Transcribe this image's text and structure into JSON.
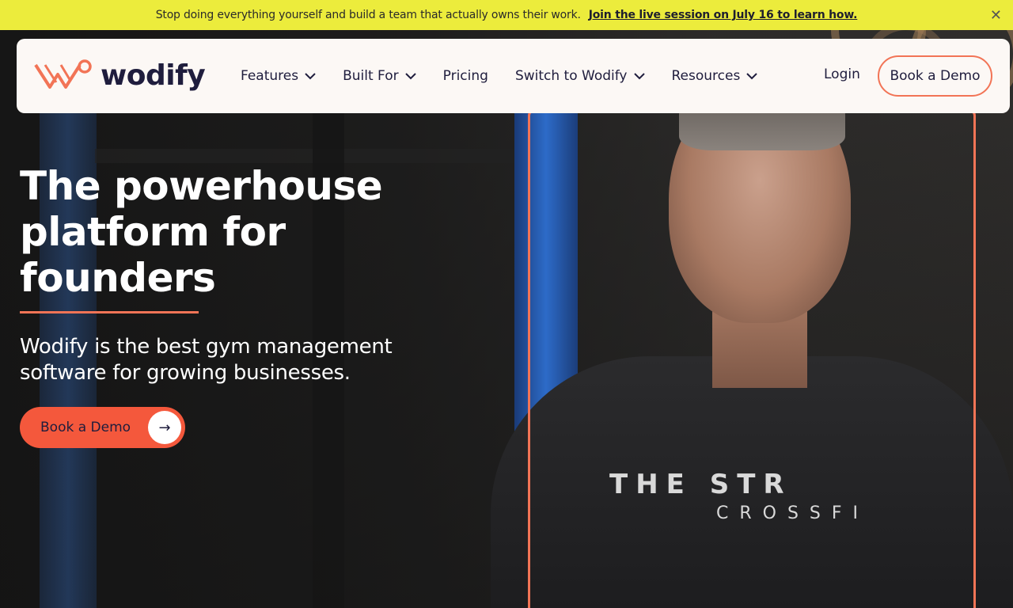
{
  "announcement": {
    "text": "Stop doing everything yourself and build a team that actually owns their work.",
    "link": "Join the live session on July 16 to learn how.",
    "close_glyph": "✕"
  },
  "nav": {
    "logo_text": "wodify",
    "items": [
      {
        "label": "Features",
        "dropdown": true
      },
      {
        "label": "Built For",
        "dropdown": true
      },
      {
        "label": "Pricing",
        "dropdown": false
      },
      {
        "label": "Switch to Wodify",
        "dropdown": true
      },
      {
        "label": "Resources",
        "dropdown": true
      }
    ],
    "login": "Login",
    "demo": "Book a Demo"
  },
  "hero": {
    "headline_line1": "The powerhouse",
    "headline_line2": "platform for",
    "headline_line3": "founders",
    "subhead_line1": "Wodify is the best gym management",
    "subhead_line2": "software for growing businesses.",
    "cta": "Book a Demo",
    "cta_arrow": "→",
    "shirt_logo_line1": "THE STR",
    "shirt_logo_line2": "CROSSFI"
  },
  "colors": {
    "accent": "#f27456",
    "cta": "#f4583c",
    "banner": "#ecec3c",
    "navy": "#1f1d3d"
  }
}
